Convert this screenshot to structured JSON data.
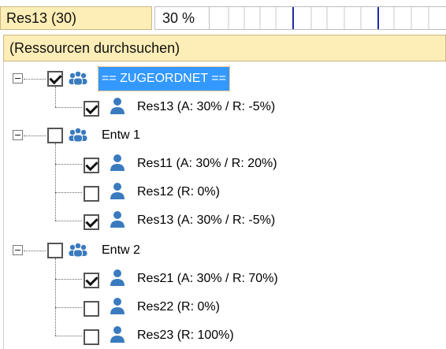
{
  "header": {
    "resource_label": "Res13 (30)",
    "percent_value": "30 %",
    "timeline_marker_color": "#1a2aa8"
  },
  "search": {
    "placeholder": "(Ressourcen durchsuchen)"
  },
  "tree": {
    "groups": [
      {
        "label": "== ZUGEORDNET ==",
        "checked": true,
        "selected": true,
        "expanded": true,
        "icon": "group-icon",
        "children": [
          {
            "label": "Res13 (A: 30% / R: -5%)",
            "checked": true,
            "icon": "person-icon"
          }
        ]
      },
      {
        "label": "Entw 1",
        "checked": false,
        "selected": false,
        "expanded": true,
        "icon": "group-icon",
        "children": [
          {
            "label": "Res11 (A: 30% / R: 20%)",
            "checked": true,
            "icon": "person-icon"
          },
          {
            "label": "Res12 (R: 0%)",
            "checked": false,
            "icon": "person-icon"
          },
          {
            "label": "Res13 (A: 30% / R: -5%)",
            "checked": true,
            "icon": "person-icon"
          }
        ]
      },
      {
        "label": "Entw 2",
        "checked": false,
        "selected": false,
        "expanded": true,
        "icon": "group-icon",
        "children": [
          {
            "label": "Res21 (A: 30% / R: 70%)",
            "checked": true,
            "icon": "person-icon"
          },
          {
            "label": "Res22 (R: 0%)",
            "checked": false,
            "icon": "person-icon"
          },
          {
            "label": "Res23 (R: 100%)",
            "checked": false,
            "icon": "person-icon"
          }
        ]
      }
    ]
  },
  "colors": {
    "header_bg": "#fdedb6",
    "selection_bg": "#3399ff",
    "icon_blue": "#3a7bbf"
  }
}
